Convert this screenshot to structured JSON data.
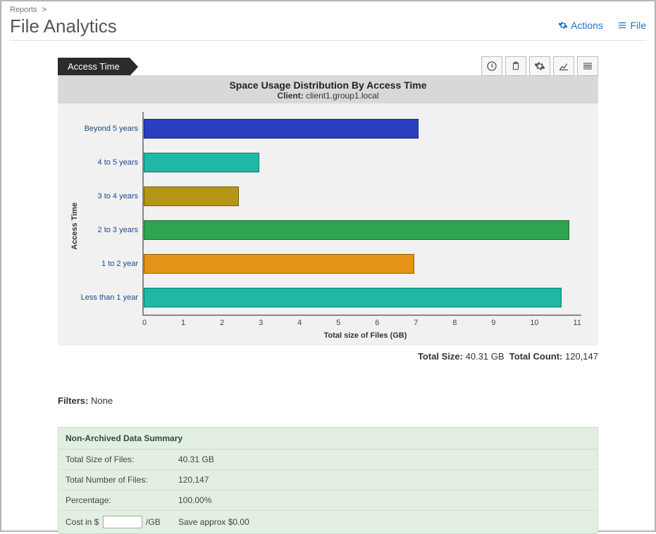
{
  "breadcrumb": {
    "root": "Reports",
    "sep": ">"
  },
  "page_title": "File Analytics",
  "actions": {
    "actions_label": "Actions",
    "file_label": "File"
  },
  "ribbon": "Access Time",
  "chart_header": {
    "title": "Space Usage Distribution By Access Time",
    "client_label": "Client:",
    "client_value": "client1.group1.local"
  },
  "chart_data": {
    "type": "bar",
    "orientation": "horizontal",
    "categories": [
      "Beyond 5 years",
      "4 to 5 years",
      "3 to 4 years",
      "2 to 3 years",
      "1 to 2 year",
      "Less than 1 year"
    ],
    "values": [
      6.9,
      2.9,
      2.4,
      10.7,
      6.8,
      10.5
    ],
    "colors": [
      "#2a3fbf",
      "#1fb8a6",
      "#b49516",
      "#2ea44f",
      "#e39416",
      "#1fb8a6"
    ],
    "xlabel": "Total size of Files (GB)",
    "ylabel": "Access Time",
    "xlim": [
      0,
      11
    ],
    "xticks": [
      0,
      1,
      2,
      3,
      4,
      5,
      6,
      7,
      8,
      9,
      10,
      11
    ]
  },
  "totals": {
    "size_label": "Total Size:",
    "size_value": "40.31 GB",
    "count_label": "Total Count:",
    "count_value": "120,147"
  },
  "filters": {
    "label": "Filters:",
    "value": "None"
  },
  "summary": {
    "header": "Non-Archived Data Summary",
    "rows": {
      "total_size_label": "Total Size of Files:",
      "total_size_value": "40.31 GB",
      "total_num_label": "Total Number of Files:",
      "total_num_value": "120,147",
      "pct_label": "Percentage:",
      "pct_value": "100.00%",
      "cost_label": "Cost in $",
      "cost_unit": "/GB",
      "cost_save": "Save approx $0.00"
    }
  },
  "icons": {
    "gear": "gear-icon",
    "menu": "menu-icon",
    "clock": "clock-icon",
    "clipboard": "clipboard-icon",
    "settings": "settings-icon",
    "chart": "chart-icon",
    "bars": "bars-icon"
  }
}
